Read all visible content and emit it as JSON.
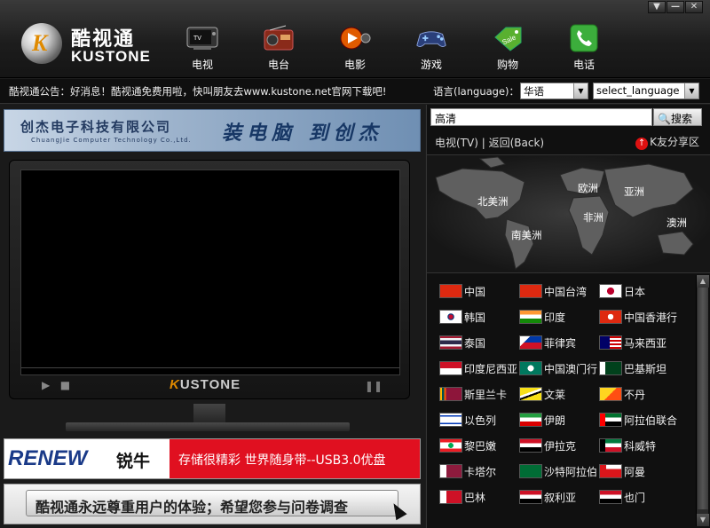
{
  "app": {
    "title_cn": "酷视通",
    "title_en": "KUSTONE",
    "logo_letter": "K"
  },
  "window_controls": [
    "▼",
    "—",
    "✕"
  ],
  "nav": [
    {
      "label": "电视",
      "icon": "tv-icon"
    },
    {
      "label": "电台",
      "icon": "radio-icon"
    },
    {
      "label": "电影",
      "icon": "movie-icon"
    },
    {
      "label": "游戏",
      "icon": "gamepad-icon"
    },
    {
      "label": "购物",
      "icon": "shopping-icon"
    },
    {
      "label": "电话",
      "icon": "phone-icon"
    }
  ],
  "notice": {
    "text": "酷视通公告：好消息！酷视通免费用啦，快叫朋友去www.kustone.net官网下载吧!",
    "language_label": "语言(language)：",
    "language_value": "华语",
    "select_language": "select_language"
  },
  "banner": {
    "company": "创杰电子科技有限公司",
    "company_en": "ChuangJie Computer Technology Co.,Ltd.",
    "slogan": "装电脑 到创杰"
  },
  "player": {
    "brand_k": "K",
    "brand_rest": "USTONE"
  },
  "ads": {
    "renew_brand": "RENEW",
    "renew_cn": "锐牛",
    "renew_text": "存储很精彩 世界随身带--USB3.0优盘",
    "survey": "酷视通永远尊重用户的体验；希望您参与问卷调查"
  },
  "search": {
    "value": "高清",
    "button": "搜索"
  },
  "tvnav": {
    "path": "电视(TV) | 返回(Back)",
    "share": "K友分享区"
  },
  "map": {
    "labels": [
      "北美洲",
      "欧洲",
      "亚洲",
      "非洲",
      "南美洲",
      "澳洲"
    ]
  },
  "countries": [
    "中国",
    "中国台湾",
    "日本",
    "韩国",
    "印度",
    "中国香港行",
    "泰国",
    "菲律宾",
    "马来西亚",
    "印度尼西亚",
    "中国澳门行",
    "巴基斯坦",
    "斯里兰卡",
    "文莱",
    "不丹",
    "以色列",
    "伊朗",
    "阿拉伯联合",
    "黎巴嫩",
    "伊拉克",
    "科威特",
    "卡塔尔",
    "沙特阿拉伯",
    "阿曼",
    "巴林",
    "叙利亚",
    "也门"
  ],
  "colors": {
    "accent": "#e08a00",
    "ad_red": "#e01020",
    "bg": "#1c1c1c"
  }
}
